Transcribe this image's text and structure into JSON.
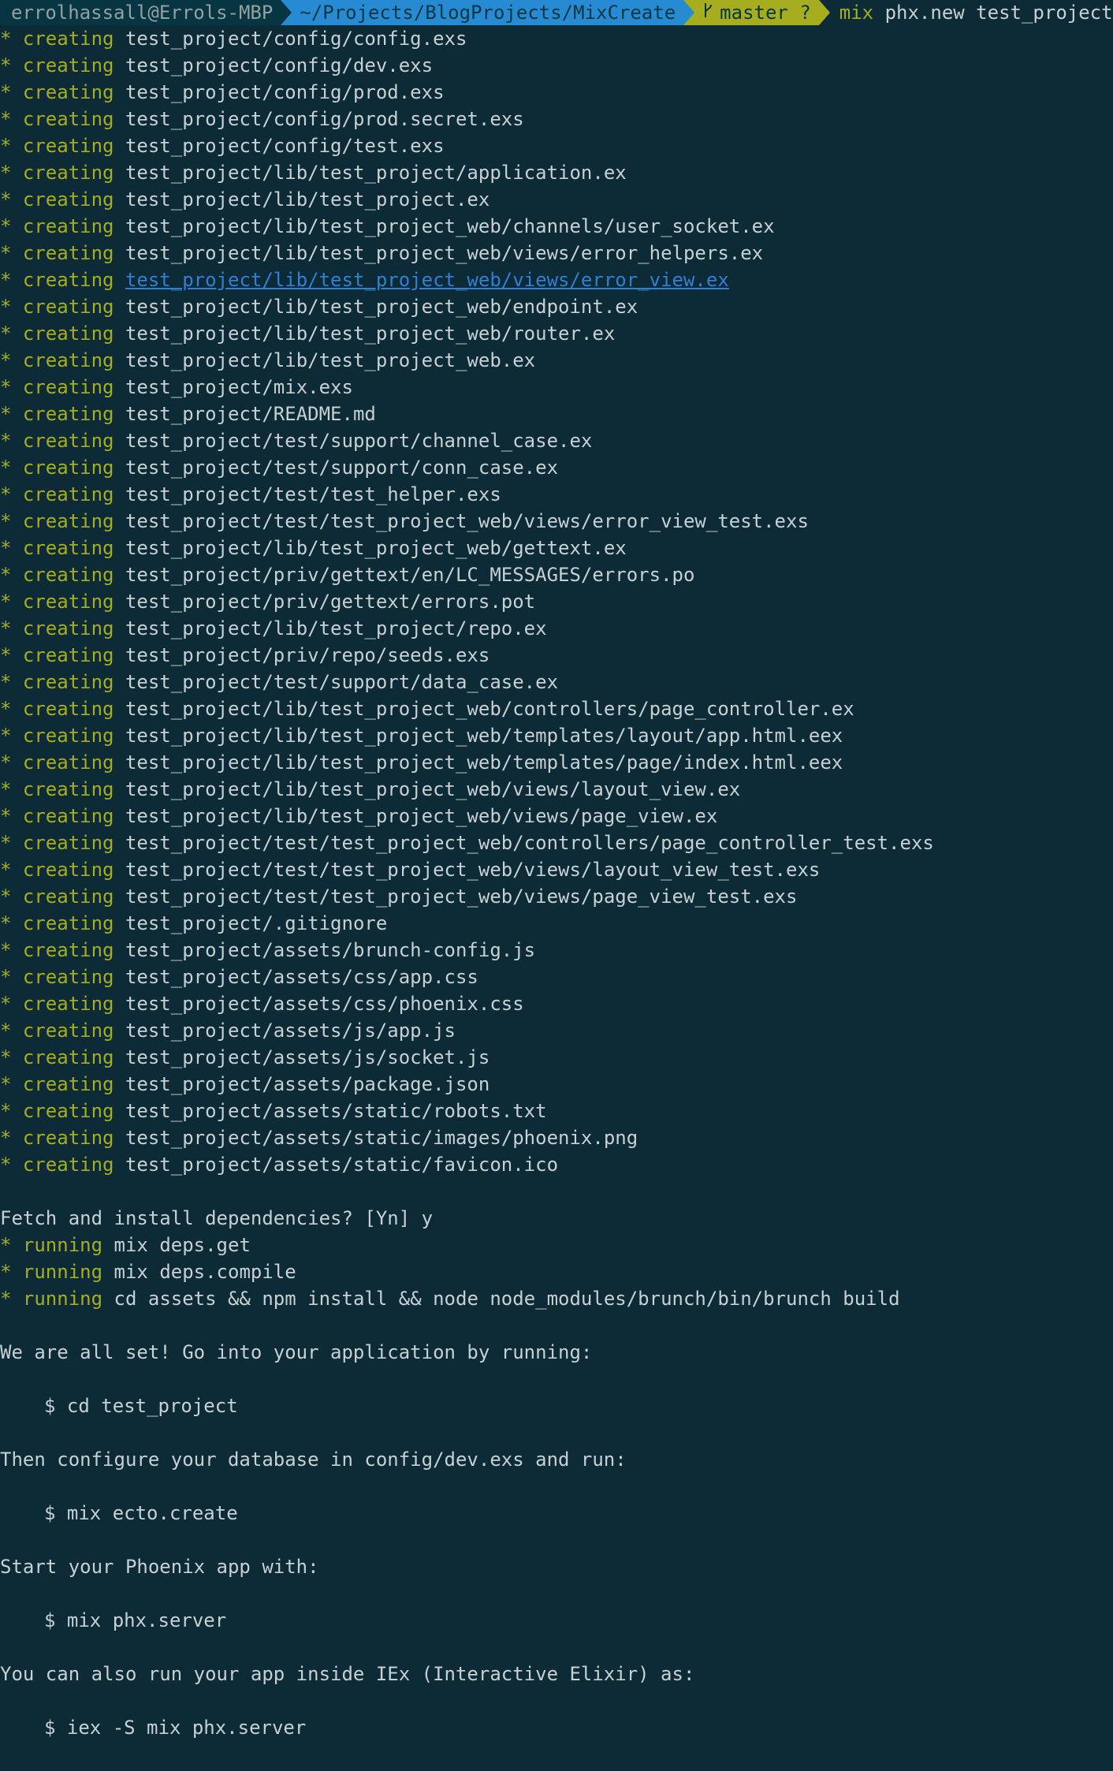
{
  "prompt": {
    "user": "errolhassall@Errols-MBP",
    "path": "~/Projects/BlogProjects/MixCreate",
    "branch_icon": "git-branch-icon",
    "branch": "master ?",
    "command_word": "mix",
    "command_rest": " phx.new test_project"
  },
  "bullet": "*",
  "creating_label": "creating",
  "running_label": "running",
  "created_files": [
    "test_project/config/config.exs",
    "test_project/config/dev.exs",
    "test_project/config/prod.exs",
    "test_project/config/prod.secret.exs",
    "test_project/config/test.exs",
    "test_project/lib/test_project/application.ex",
    "test_project/lib/test_project.ex",
    "test_project/lib/test_project_web/channels/user_socket.ex",
    "test_project/lib/test_project_web/views/error_helpers.ex",
    "test_project/lib/test_project_web/views/error_view.ex",
    "test_project/lib/test_project_web/endpoint.ex",
    "test_project/lib/test_project_web/router.ex",
    "test_project/lib/test_project_web.ex",
    "test_project/mix.exs",
    "test_project/README.md",
    "test_project/test/support/channel_case.ex",
    "test_project/test/support/conn_case.ex",
    "test_project/test/test_helper.exs",
    "test_project/test/test_project_web/views/error_view_test.exs",
    "test_project/lib/test_project_web/gettext.ex",
    "test_project/priv/gettext/en/LC_MESSAGES/errors.po",
    "test_project/priv/gettext/errors.pot",
    "test_project/lib/test_project/repo.ex",
    "test_project/priv/repo/seeds.exs",
    "test_project/test/support/data_case.ex",
    "test_project/lib/test_project_web/controllers/page_controller.ex",
    "test_project/lib/test_project_web/templates/layout/app.html.eex",
    "test_project/lib/test_project_web/templates/page/index.html.eex",
    "test_project/lib/test_project_web/views/layout_view.ex",
    "test_project/lib/test_project_web/views/page_view.ex",
    "test_project/test/test_project_web/controllers/page_controller_test.exs",
    "test_project/test/test_project_web/views/layout_view_test.exs",
    "test_project/test/test_project_web/views/page_view_test.exs",
    "test_project/.gitignore",
    "test_project/assets/brunch-config.js",
    "test_project/assets/css/app.css",
    "test_project/assets/css/phoenix.css",
    "test_project/assets/js/app.js",
    "test_project/assets/js/socket.js",
    "test_project/assets/package.json",
    "test_project/assets/static/robots.txt",
    "test_project/assets/static/images/phoenix.png",
    "test_project/assets/static/favicon.ico"
  ],
  "fetch_prompt": "Fetch and install dependencies? [Yn] y",
  "running_commands": [
    "mix deps.get",
    "mix deps.compile",
    "cd assets && npm install && node node_modules/brunch/bin/brunch build"
  ],
  "messages": {
    "all_set": "We are all set! Go into your application by running:",
    "cd_cmd": "$ cd test_project",
    "configure": "Then configure your database in config/dev.exs and run:",
    "ecto_cmd": "$ mix ecto.create",
    "start": "Start your Phoenix app with:",
    "server_cmd": "$ mix phx.server",
    "iex_text": "You can also run your app inside IEx (Interactive Elixir) as:",
    "iex_cmd": "$ iex -S mix phx.server"
  }
}
